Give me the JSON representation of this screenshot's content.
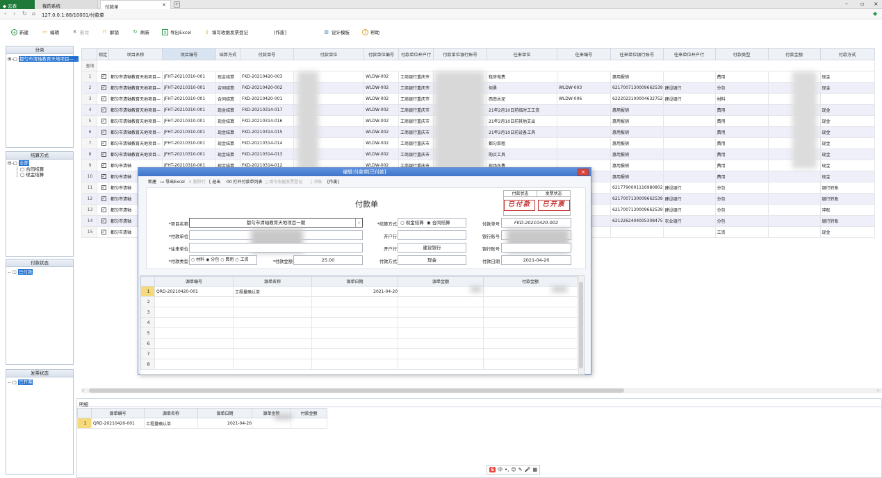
{
  "browser": {
    "app_tab": "云表",
    "sys_tab": "我的系统",
    "page_tab": "付款单",
    "url": "127.0.0.1:88/10001/付款单"
  },
  "toolbar": [
    {
      "name": "new-button",
      "label": "新建",
      "icon": "plus-icon"
    },
    {
      "name": "edit-button",
      "label": "编辑",
      "icon": "folder-icon"
    },
    {
      "name": "delete-button",
      "label": "删除",
      "icon": "x-icon"
    },
    {
      "name": "unlock-button",
      "label": "解锁",
      "icon": "lock-icon"
    },
    {
      "name": "refresh-button",
      "label": "刷新",
      "icon": "refresh-icon"
    },
    {
      "name": "export-excel-button",
      "label": "导出Excel",
      "icon": "excel-icon"
    },
    {
      "name": "fill-invoice-button",
      "label": "填写收据发票登记",
      "icon": "doc-icon"
    },
    {
      "name": "void-button",
      "label": "[作废]",
      "icon": ""
    },
    {
      "name": "design-template-button",
      "label": "设计模板",
      "icon": "layout-icon"
    },
    {
      "name": "help-button",
      "label": "帮助",
      "icon": "help-icon"
    }
  ],
  "left_panels": {
    "category": {
      "title": "分类",
      "item": "都匀市清轴教育天地项目—..."
    },
    "settle": {
      "title": "结算方式",
      "root": "全部",
      "items": [
        "合同结算",
        "现金结算"
      ]
    },
    "pay_status": {
      "title": "付款状态",
      "item": "已付款"
    },
    "invoice_status": {
      "title": "发票状态",
      "item": "已开票"
    }
  },
  "grid": {
    "headers": [
      "锁定",
      "项目名称",
      "项目编号",
      "结算方式",
      "付款单号",
      "付款单位",
      "付款单位编号",
      "付款单位开户行",
      "付款单位银行账号",
      "往来单位",
      "往来编号",
      "往来单位银行账号",
      "往来单位开户行",
      "付款类型",
      "付款金额",
      "付款方式"
    ],
    "query_label": "查询",
    "rows": [
      [
        "1",
        "都匀市清轴教育天地项目—",
        "JFHT-20210310-001",
        "现金结算",
        "FKD-20210420-003",
        "",
        "WLDW-002",
        "工商银行重庆市",
        "",
        "租房电费",
        "",
        "惠用报销",
        "",
        "费用",
        "",
        "现金"
      ],
      [
        "2",
        "都匀市清轴教育天地项目—",
        "JFHT-20210310-001",
        "合同结算",
        "FKD-20210420-002",
        "",
        "WLDW-002",
        "工商银行重庆市",
        "",
        "何勇",
        "WLDW-003",
        "6217007130009662539",
        "建设银行",
        "分包",
        "",
        "现金"
      ],
      [
        "3",
        "都匀市清轴教育天地项目—",
        "JFHT-20210310-001",
        "合同结算",
        "FKD-20210420-001",
        "",
        "WLDW-002",
        "工商银行重庆市",
        "",
        "西南水泥",
        "WLDW-006",
        "6222023100004632752",
        "建设银行",
        "材料",
        "",
        ""
      ],
      [
        "4",
        "都匀市清轴教育天地项目—",
        "JFHT-20210310-001",
        "现金结算",
        "FKD-20210314-017",
        "",
        "WLDW-002",
        "工商银行重庆市",
        "",
        "21年2月10日前临时工工资",
        "",
        "惠用报销",
        "",
        "费用",
        "",
        "现金"
      ],
      [
        "5",
        "都匀市清轴教育天地项目—",
        "JFHT-20210310-001",
        "现金结算",
        "FKD-20210314-016",
        "",
        "WLDW-002",
        "工商银行重庆市",
        "",
        "21年2月10日前其他支出",
        "",
        "惠用报销",
        "",
        "费用",
        "",
        "现金"
      ],
      [
        "6",
        "都匀市清轴教育天地项目—",
        "JFHT-20210310-001",
        "现金结算",
        "FKD-20210314-015",
        "",
        "WLDW-002",
        "工商银行重庆市",
        "",
        "21年2月10日前设备工具",
        "",
        "惠用报销",
        "",
        "费用",
        "",
        "现金"
      ],
      [
        "7",
        "都匀市清轴教育天地项目—",
        "JFHT-20210310-001",
        "现金结算",
        "FKD-20210314-014",
        "",
        "WLDW-002",
        "工商银行重庆市",
        "",
        "都匀菜租",
        "",
        "惠用报销",
        "",
        "费用",
        "",
        "现金"
      ],
      [
        "8",
        "都匀市清轴教育天地项目—",
        "JFHT-20210310-001",
        "现金结算",
        "FKD-20210314-013",
        "",
        "WLDW-002",
        "工商银行重庆市",
        "",
        "购买工具",
        "",
        "惠用报销",
        "",
        "费用",
        "",
        "现金"
      ],
      [
        "9",
        "都匀市清轴",
        "JFHT-20210310-001",
        "现金结算",
        "FKD-20210314-012",
        "",
        "WLDW-002",
        "工商银行重庆市",
        "",
        "现场水费",
        "",
        "惠用报销",
        "",
        "费用",
        "",
        "现金"
      ],
      [
        "10",
        "都匀市清轴",
        "",
        "",
        "",
        "",
        "",
        "",
        "",
        "",
        "",
        "惠用报销",
        "",
        "费用",
        "",
        "现金"
      ],
      [
        "11",
        "都匀市清轴",
        "",
        "",
        "",
        "",
        "",
        "",
        "",
        "",
        "",
        "6217790001116980802",
        "建设银行",
        "分包",
        "",
        "银行转账"
      ],
      [
        "12",
        "都匀市清轴",
        "",
        "",
        "",
        "",
        "",
        "",
        "",
        "",
        "",
        "6217007130009662539",
        "建设银行",
        "分包",
        "",
        "银行转账"
      ],
      [
        "13",
        "都匀市清轴",
        "",
        "",
        "",
        "",
        "",
        "",
        "",
        "",
        "",
        "6217007130009662539",
        "建设银行",
        "分包",
        "",
        "冲账"
      ],
      [
        "14",
        "都匀市清轴",
        "",
        "",
        "",
        "",
        "",
        "",
        "",
        "",
        "",
        "6212262404005308475",
        "农业银行",
        "分包",
        "",
        "银行转账"
      ],
      [
        "15",
        "都匀市清轴",
        "",
        "",
        "",
        "",
        "",
        "",
        "",
        "",
        "",
        "",
        "",
        "工资",
        "",
        "现金"
      ]
    ]
  },
  "detail": {
    "tab": "明细",
    "headers": [
      "源单编号",
      "源单名称",
      "源单日期",
      "源单金额",
      "付款金额"
    ],
    "rows": [
      [
        "1",
        "QRD-20210420-001",
        "工程量确认单",
        "2021-04-20",
        "",
        ""
      ]
    ]
  },
  "dialog": {
    "title": "编辑:付款单[已付款]",
    "close": "×",
    "toolbar": [
      "新建",
      "导出Excel",
      "删除行",
      "退出",
      "打开付款单列表",
      "填写收据发票登记",
      "冲账",
      "[作废]"
    ],
    "form_title": "付款单",
    "status_headers": [
      "付款状态",
      "发票状态"
    ],
    "stamps": [
      "已付款",
      "已开票"
    ],
    "labels": {
      "project": "*项目名称",
      "pay_unit": "*付款单位",
      "to_unit": "*往来单位",
      "pay_type": "*付款类型",
      "amount": "*付款金额",
      "settle": "*结算方式",
      "bank1": "开户行",
      "bank2": "开户行",
      "pay_method": "付款方式",
      "pay_no": "付款单号",
      "account1": "银行账号",
      "account2": "银行账号",
      "pay_date": "付款日期"
    },
    "values": {
      "project": "都匀市清轴教育天地项目一期",
      "amount": "25.00",
      "bank2": "建设银行",
      "pay_method": "现金",
      "pay_no": "FKD-20210420-002",
      "pay_date": "2021-04-20"
    },
    "settle_options": [
      "现金结算",
      "合同结算"
    ],
    "settle_selected": "合同结算",
    "type_options": [
      "材料",
      "分包",
      "费用",
      "工资"
    ],
    "type_selected": "分包",
    "sub_headers": [
      "源单编号",
      "源单名称",
      "源单日期",
      "源单金额",
      "付款金额"
    ],
    "sub_rows": [
      [
        "1",
        "QRD-20210420-001",
        "工程量确认单",
        "2021-04-20",
        "",
        ""
      ],
      [
        "2",
        "",
        "",
        "",
        "",
        ""
      ],
      [
        "3",
        "",
        "",
        "",
        "",
        ""
      ],
      [
        "4",
        "",
        "",
        "",
        "",
        ""
      ],
      [
        "5",
        "",
        "",
        "",
        "",
        ""
      ],
      [
        "6",
        "",
        "",
        "",
        "",
        ""
      ],
      [
        "7",
        "",
        "",
        "",
        "",
        ""
      ],
      [
        "8",
        "",
        "",
        "",
        "",
        ""
      ]
    ]
  },
  "ime": {
    "logo": "S",
    "items": [
      "中",
      "•,",
      "☺",
      "✎",
      "🎤",
      "▦"
    ]
  }
}
